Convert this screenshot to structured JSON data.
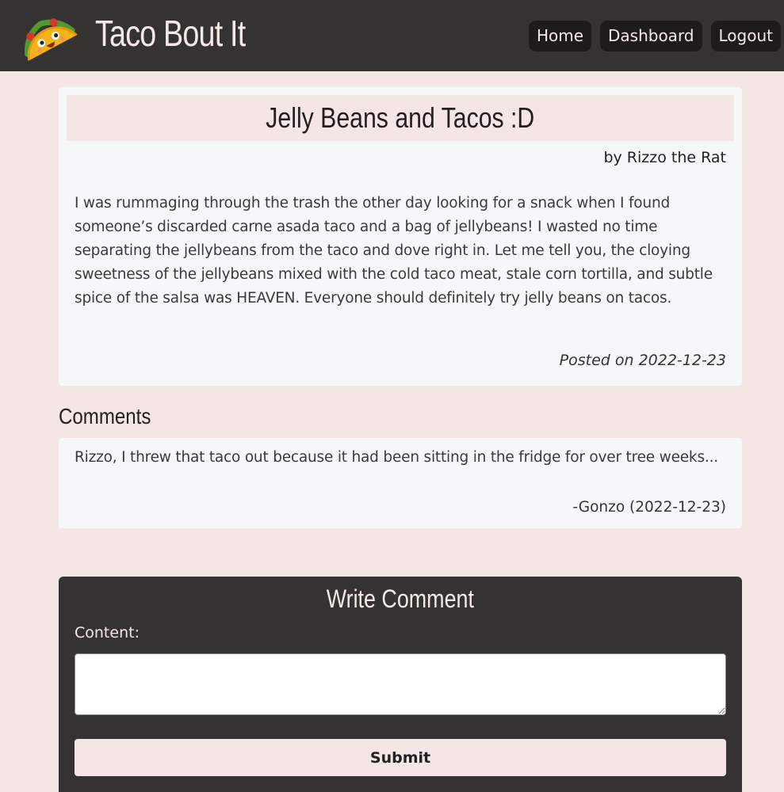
{
  "header": {
    "title": "Taco Bout It",
    "nav": {
      "home": "Home",
      "dashboard": "Dashboard",
      "logout": "Logout"
    }
  },
  "post": {
    "title": "Jelly Beans and Tacos :D",
    "author": "by Rizzo the Rat",
    "body": "I was rummaging through the trash the other day looking for a snack when I found someone’s discarded carne asada taco and a bag of jellybeans! I wasted no time separating the jellybeans from the taco and dove right in. Let me tell you, the cloying sweetness of the jellybeans mixed with the cold taco meat, stale corn tortilla, and subtle spice of the salsa was HEAVEN. Everyone should definitely try jelly beans on tacos.",
    "date": "Posted on 2022-12-23"
  },
  "comments": {
    "heading": "Comments",
    "items": [
      {
        "text": "Rizzo, I threw that taco out because it had been sitting in the fridge for over tree weeks...",
        "meta": "-Gonzo (2022-12-23)"
      }
    ]
  },
  "form": {
    "heading": "Write Comment",
    "label": "Content:",
    "value": "",
    "submit": "Submit"
  },
  "icons": {
    "logo": "taco-icon"
  },
  "colors": {
    "header_bg": "#353331",
    "page_bg": "#f5e6e6",
    "card_bg": "#f6f7f9",
    "accent": "#f6e8e5"
  }
}
